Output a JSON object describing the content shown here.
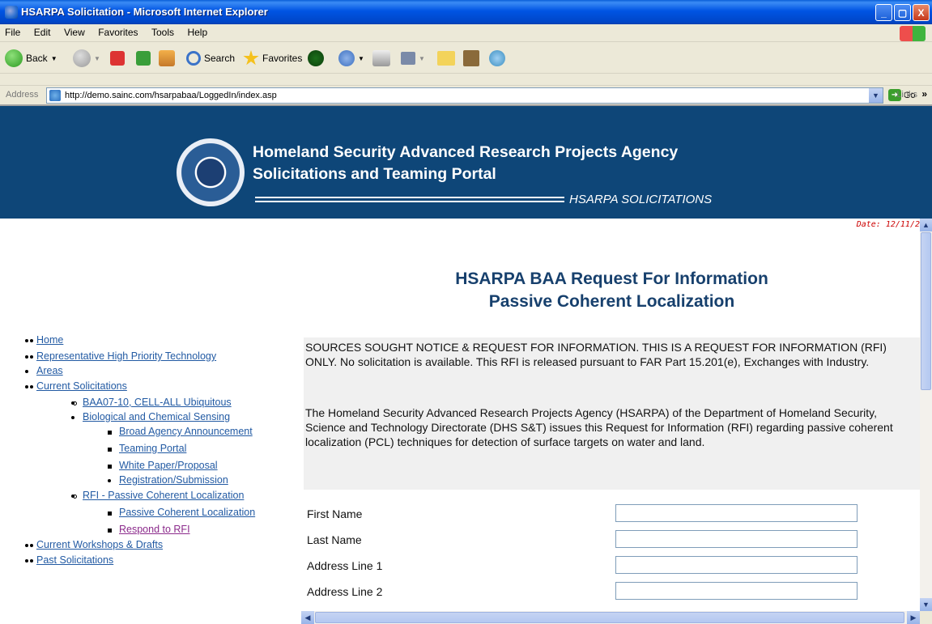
{
  "window": {
    "title": "HSARPA Solicitation - Microsoft Internet Explorer",
    "buttons": [
      "_",
      "▢",
      "X"
    ]
  },
  "menubar": {
    "items": [
      "File",
      "Edit",
      "View",
      "Favorites",
      "Tools",
      "Help"
    ]
  },
  "toolbar": {
    "back_label": "Back",
    "search_label": "Search",
    "favorites_label": "Favorites"
  },
  "address": {
    "label": "Address",
    "url": "http://demo.sainc.com/hsarpabaa/LoggedIn/index.asp",
    "go_label": "Go",
    "links_label": "Links"
  },
  "banner": {
    "line1": "Homeland Security Advanced Research Projects Agency",
    "line2": "Solicitations and Teaming Portal",
    "tagline": "HSARPA SOLICITATIONS"
  },
  "sidebar": {
    "home": "Home",
    "priority_1": "Representative High Priority Technology",
    "priority_2": "Areas",
    "current_solicitations": "Current Solicitations",
    "baa_1": "BAA07-10, CELL-ALL Ubiquitous",
    "baa_2": "Biological and Chemical Sensing",
    "broad_agency": "Broad Agency Announcement",
    "teaming_portal": "Teaming Portal",
    "white_paper_1": "White Paper/Proposal",
    "white_paper_2": "Registration/Submission",
    "rfi": "RFI - Passive Coherent Localization",
    "pcl": "Passive Coherent Localization",
    "respond": "Respond to RFI",
    "workshops": "Current Workshops & Drafts",
    "past": "Past Solicitations"
  },
  "main": {
    "date": "Date: 12/11/2",
    "title_1": "HSARPA BAA Request For Information",
    "title_2": "Passive Coherent Localization",
    "notice_1": "SOURCES SOUGHT NOTICE & REQUEST FOR INFORMATION. THIS IS A REQUEST FOR INFORMATION (RFI) ONLY. No solicitation is available. This RFI is released pursuant to FAR Part 15.201(e), Exchanges with Industry.",
    "notice_2": "The Homeland Security Advanced Research Projects Agency (HSARPA) of the Department of Homeland Security, Science and Technology Directorate (DHS S&T) issues this Request for Information (RFI) regarding passive coherent localization (PCL) techniques for detection of surface targets on water and land.",
    "fields": [
      {
        "label": "First Name",
        "value": ""
      },
      {
        "label": "Last Name",
        "value": ""
      },
      {
        "label": "Address Line 1",
        "value": ""
      },
      {
        "label": "Address Line 2",
        "value": ""
      }
    ]
  }
}
